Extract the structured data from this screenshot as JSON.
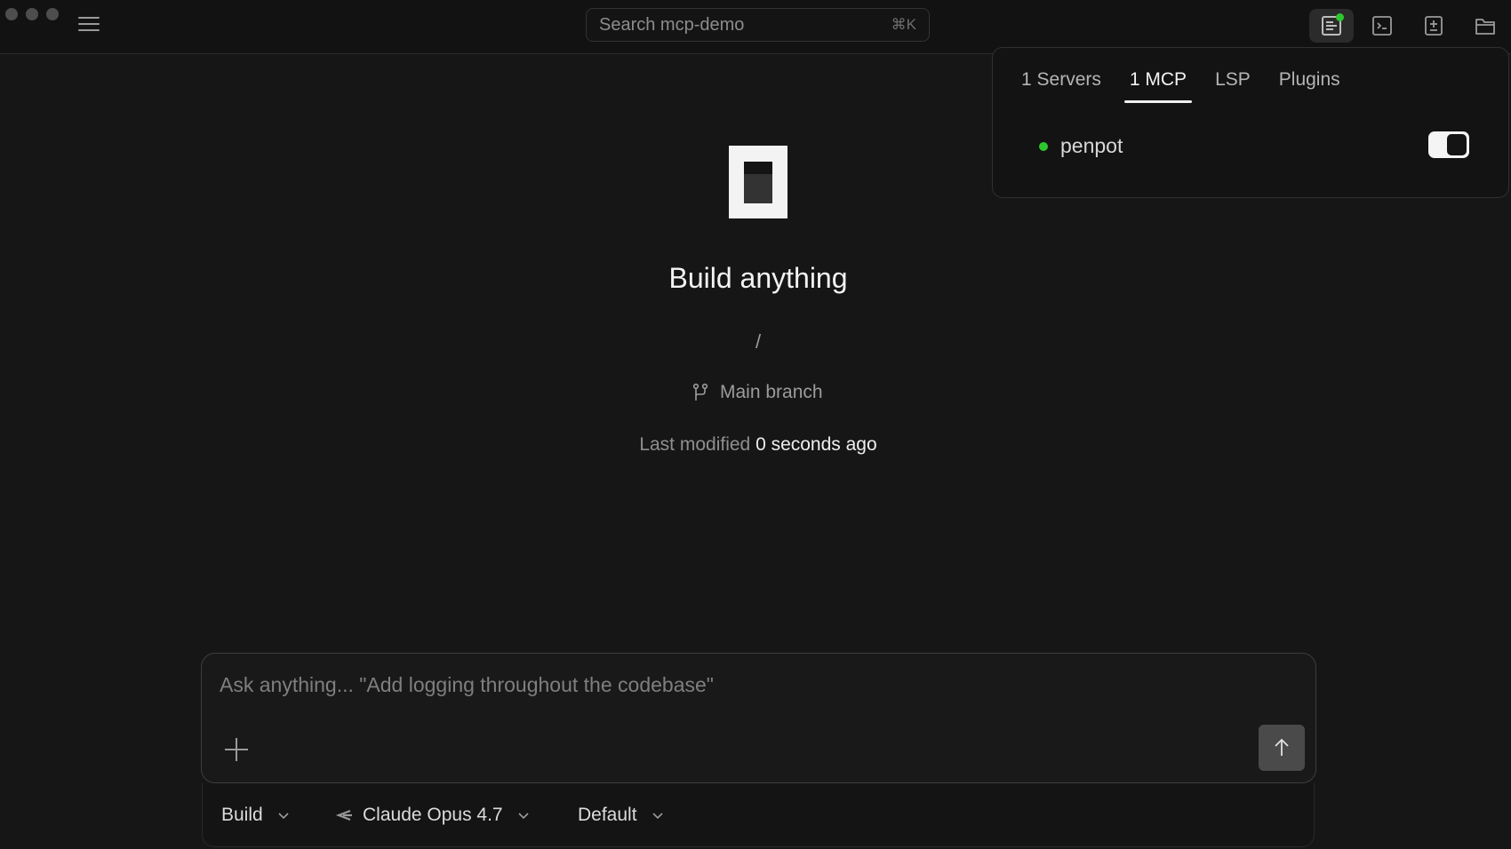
{
  "search": {
    "placeholder": "Search mcp-demo",
    "shortcut": "⌘K"
  },
  "popover": {
    "tabs": [
      {
        "label": "1 Servers"
      },
      {
        "label": "1 MCP"
      },
      {
        "label": "LSP"
      },
      {
        "label": "Plugins"
      }
    ],
    "active_tab": "1 MCP",
    "servers": [
      {
        "name": "penpot",
        "status": "connected",
        "enabled": true
      }
    ]
  },
  "hero": {
    "title": "Build anything",
    "path": "/",
    "branch": "Main branch",
    "modified_label": "Last modified",
    "modified_value": "0 seconds ago"
  },
  "composer": {
    "placeholder": "Ask anything... \"Add logging throughout the codebase\""
  },
  "toolbar": {
    "mode": "Build",
    "model": "Claude Opus 4.7",
    "variant": "Default"
  },
  "colors": {
    "accent_green": "#2dc72d",
    "background": "#161616"
  }
}
